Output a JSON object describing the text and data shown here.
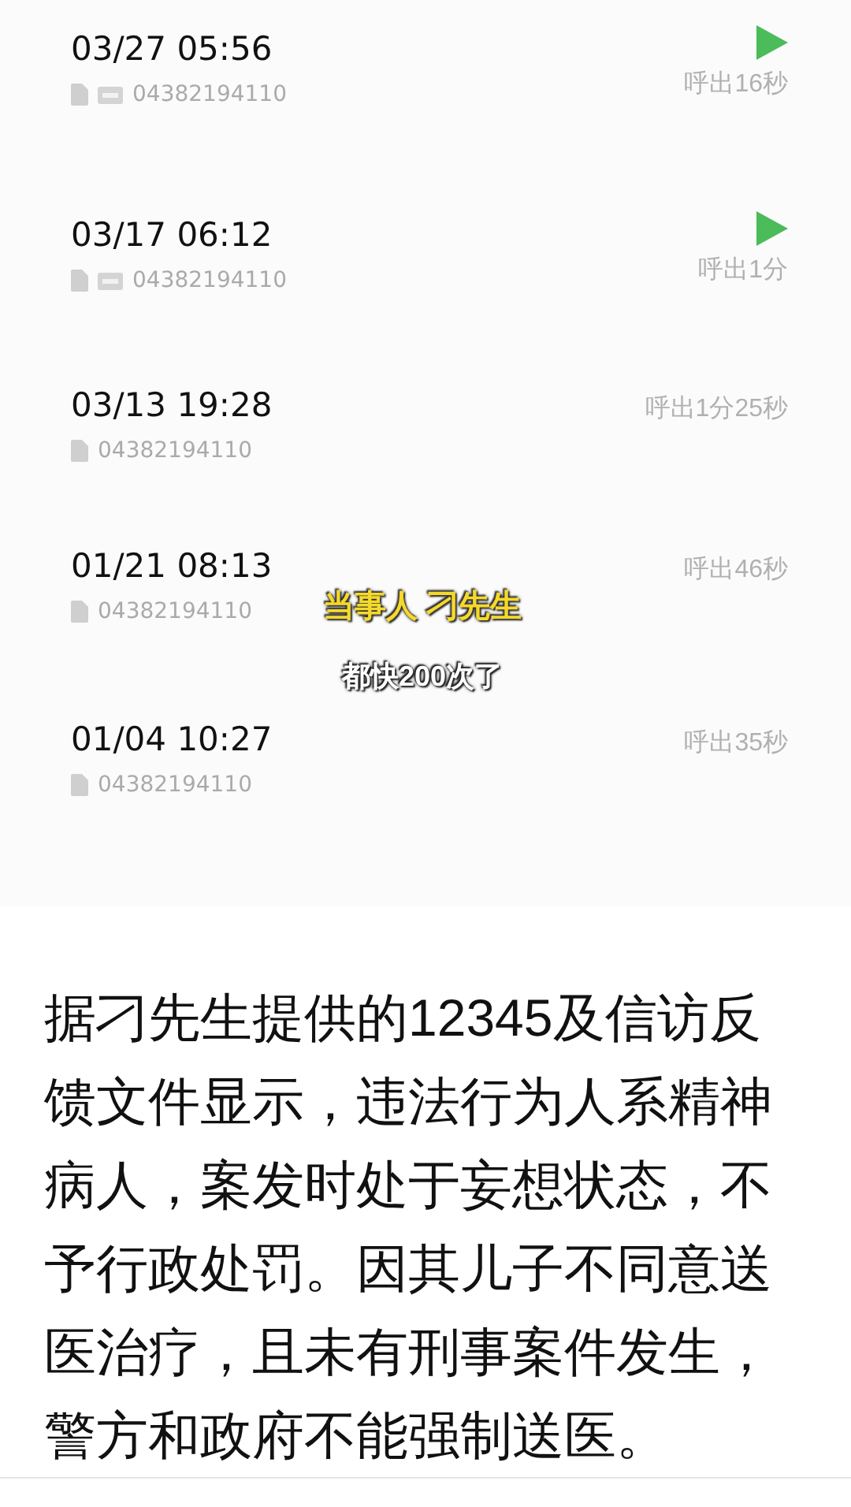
{
  "call_log": [
    {
      "time": "03/27 05:56",
      "hd": true,
      "number": "04382194110",
      "recording": true,
      "duration": "呼出16秒"
    },
    {
      "time": "03/17 06:12",
      "hd": true,
      "number": "04382194110",
      "recording": true,
      "duration": "呼出1分"
    },
    {
      "time": "03/13 19:28",
      "hd": false,
      "number": "04382194110",
      "recording": false,
      "duration": "呼出1分25秒"
    },
    {
      "time": "01/21 08:13",
      "hd": false,
      "number": "04382194110",
      "recording": false,
      "duration": "呼出46秒"
    },
    {
      "time": "01/04 10:27",
      "hd": false,
      "number": "04382194110",
      "recording": false,
      "duration": "呼出35秒"
    }
  ],
  "captions": [
    {
      "kind": "highlight",
      "text": "当事人 刁先生"
    },
    {
      "kind": "plain",
      "text": "都快200次了"
    }
  ],
  "article": {
    "paragraph": "据刁先生提供的12345及信访反馈文件显示，违法行为人系精神病人，案发时处于妄想状态，不予行政处罚。因其儿子不同意送医治疗，且未有刑事案件发生，警方和政府不能强制送医。"
  }
}
